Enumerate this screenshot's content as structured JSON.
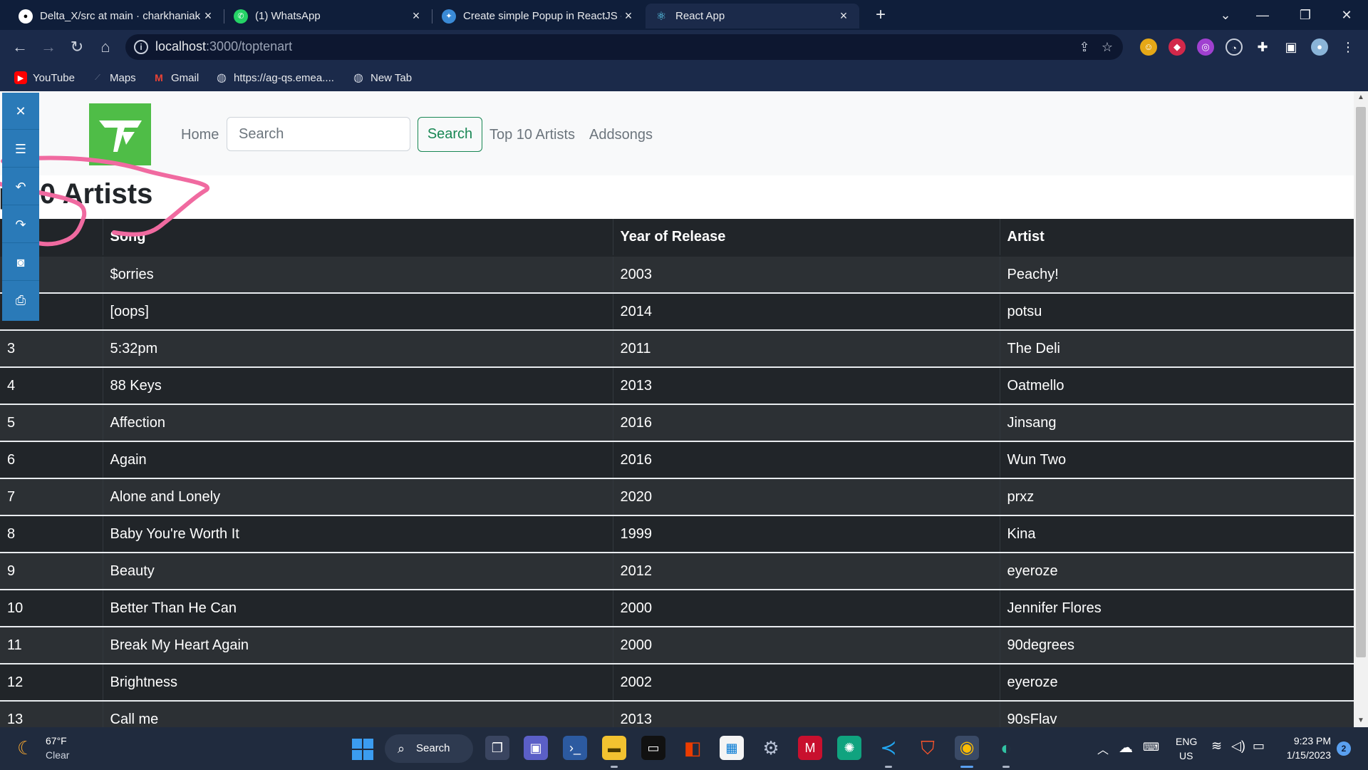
{
  "browser": {
    "tabs": [
      {
        "title": "Delta_X/src at main · charkhaniak",
        "icon": "github-icon"
      },
      {
        "title": "(1) WhatsApp",
        "icon": "whatsapp-icon"
      },
      {
        "title": "Create simple Popup in ReactJS -",
        "icon": "site-icon"
      },
      {
        "title": "React App",
        "icon": "react-icon",
        "active": true
      }
    ],
    "url_host": "localhost",
    "url_path": ":3000/toptenart",
    "bookmarks": [
      {
        "label": "YouTube",
        "icon": "youtube-icon"
      },
      {
        "label": "Maps",
        "icon": "maps-icon"
      },
      {
        "label": "Gmail",
        "icon": "gmail-icon"
      },
      {
        "label": "https://ag-qs.emea....",
        "icon": "globe-icon"
      },
      {
        "label": "New Tab",
        "icon": "globe-icon"
      }
    ]
  },
  "navbar": {
    "home": "Home",
    "search_placeholder": "Search",
    "search_button": "Search",
    "top10": "Top 10 Artists",
    "addsongs": "Addsongs"
  },
  "page": {
    "title": "p 10 Artists"
  },
  "table": {
    "headers": [
      "",
      "Song",
      "Year of Release",
      "Artist"
    ],
    "rows": [
      {
        "num": "",
        "song": "$orries",
        "year": "2003",
        "artist": "Peachy!"
      },
      {
        "num": "",
        "song": "[oops]",
        "year": "2014",
        "artist": "potsu"
      },
      {
        "num": "3",
        "song": "5:32pm",
        "year": "2011",
        "artist": "The Deli"
      },
      {
        "num": "4",
        "song": "88 Keys",
        "year": "2013",
        "artist": "Oatmello"
      },
      {
        "num": "5",
        "song": "Affection",
        "year": "2016",
        "artist": "Jinsang"
      },
      {
        "num": "6",
        "song": "Again",
        "year": "2016",
        "artist": "Wun Two"
      },
      {
        "num": "7",
        "song": "Alone and Lonely",
        "year": "2020",
        "artist": "prxz"
      },
      {
        "num": "8",
        "song": "Baby You're Worth It",
        "year": "1999",
        "artist": "Kina"
      },
      {
        "num": "9",
        "song": "Beauty",
        "year": "2012",
        "artist": "eyeroze"
      },
      {
        "num": "10",
        "song": "Better Than He Can",
        "year": "2000",
        "artist": "Jennifer Flores"
      },
      {
        "num": "11",
        "song": "Break My Heart Again",
        "year": "2000",
        "artist": "90degrees"
      },
      {
        "num": "12",
        "song": "Brightness",
        "year": "2002",
        "artist": "eyeroze"
      },
      {
        "num": "13",
        "song": "Call me",
        "year": "2013",
        "artist": "90sFlav"
      }
    ]
  },
  "annotation_toolbar": {
    "buttons": [
      "close-icon",
      "menu-icon",
      "undo-icon",
      "redo-icon",
      "camera-icon",
      "print-icon"
    ]
  },
  "taskbar": {
    "weather_temp": "67°F",
    "weather_desc": "Clear",
    "search_label": "Search",
    "lang_top": "ENG",
    "lang_bottom": "US",
    "time": "9:23 PM",
    "date": "1/15/2023",
    "notification_count": "2"
  },
  "colors": {
    "table_bg": "#212529",
    "navbar_bg": "#f8f9fa",
    "search_button": "#198754",
    "logo": "#4fbd47",
    "annotation_bar": "#2a7ab8",
    "pen_stroke": "#f06aa0"
  }
}
